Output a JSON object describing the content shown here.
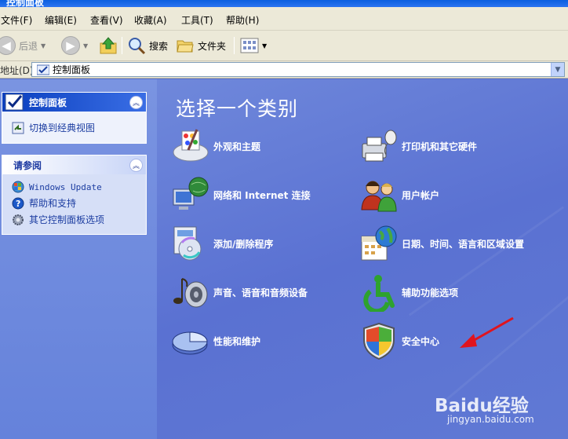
{
  "window": {
    "title": "控制面板"
  },
  "menu": [
    "文件(F)",
    "编辑(E)",
    "查看(V)",
    "收藏(A)",
    "工具(T)",
    "帮助(H)"
  ],
  "toolbar": {
    "back": "后退",
    "search": "搜索",
    "folders": "文件夹"
  },
  "address": {
    "label": "地址(D)",
    "value": "控制面板"
  },
  "sidebar": {
    "panel1": {
      "title": "控制面板",
      "items": [
        "切换到经典视图"
      ]
    },
    "panel2": {
      "title": "请参阅",
      "items": [
        "Windows Update",
        "帮助和支持",
        "其它控制面板选项"
      ]
    }
  },
  "main": {
    "heading": "选择一个类别",
    "categories": [
      "外观和主题",
      "打印机和其它硬件",
      "网络和 Internet 连接",
      "用户帐户",
      "添加/删除程序",
      "日期、时间、语言和区域设置",
      "声音、语音和音频设备",
      "辅助功能选项",
      "性能和维护",
      "安全中心"
    ]
  },
  "watermark": {
    "brand": "Baidu经验",
    "url": "jingyan.baidu.com"
  },
  "colors": {
    "accent_blue": "#0a3fbe",
    "pane_bg": "#5a72d0",
    "arrow": "#e0141e"
  }
}
